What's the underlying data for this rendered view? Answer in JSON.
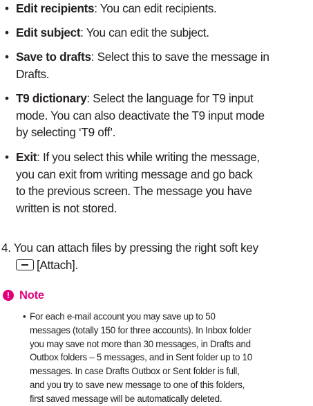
{
  "options": [
    {
      "term": "Edit recipients",
      "desc": ": You can edit recipients."
    },
    {
      "term": "Edit subject",
      "desc": ": You can edit the subject."
    },
    {
      "term": "Save to drafts",
      "desc_lines": [
        ": Select this to save the message in",
        "Drafts."
      ]
    },
    {
      "term": "T9 dictionary",
      "desc_lines": [
        ": Select the language for T9 input",
        "mode. You can also deactivate the T9 input mode",
        "by selecting ‘T9 off’."
      ]
    },
    {
      "term": "Exit",
      "desc_lines": [
        ": If you select this while writing the message,",
        "you can exit from writing message and go back",
        "to the previous screen. The message you have",
        "written is not stored."
      ]
    }
  ],
  "step4": {
    "line1": "4. You can attach files by pressing the right soft key",
    "line2": "[Attach].",
    "icon": "soft-key-icon"
  },
  "note": {
    "title": "Note",
    "icon": "note-icon",
    "icon_glyph": "!",
    "accent_color": "#e2007a",
    "lines": [
      "For each e-mail account you may save up to 50",
      "messages (totally 150 for three accounts). In Inbox folder",
      "you may save not more than 30 messages, in Drafts and",
      "Outbox folders – 5 messages, and in Sent folder up to 10",
      "messages. In case Drafts Outbox or Sent folder is full,",
      "and you try to save new message to one of this folders,",
      "first saved message will be automatically deleted."
    ]
  }
}
